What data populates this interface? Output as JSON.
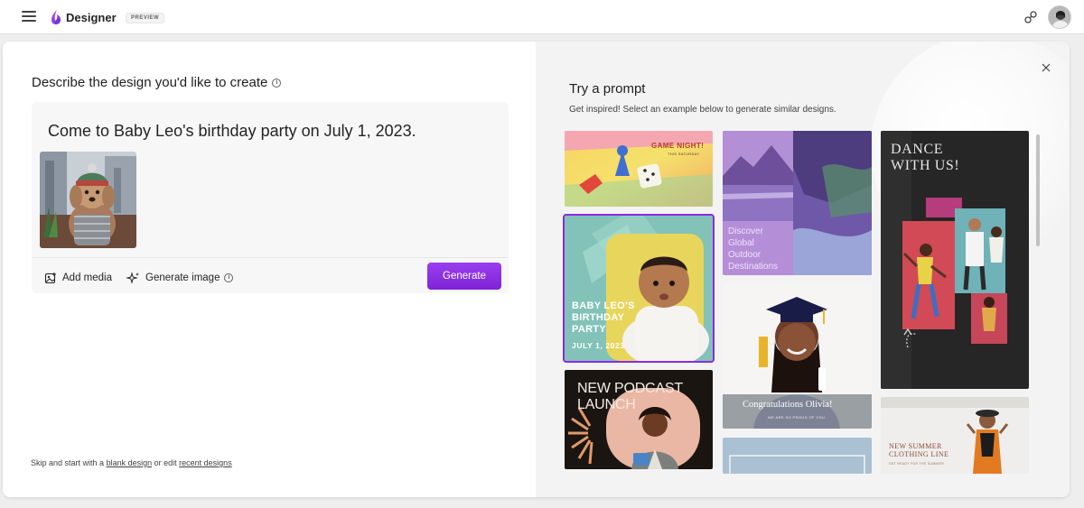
{
  "app": {
    "title": "Designer",
    "badge": "PREVIEW",
    "accent_color": "#8a2be2"
  },
  "topbar": {
    "menu_icon": "hamburger-icon",
    "share_icon": "share-link-icon",
    "avatar": "user-avatar"
  },
  "composer": {
    "heading": "Describe the design you'd like to create",
    "info_icon": "info-icon",
    "prompt_text": "Come to Baby Leo's birthday party on July 1, 2023.",
    "add_media_label": "Add media",
    "generate_image_label": "Generate image",
    "generate_button_label": "Generate"
  },
  "footer": {
    "prefix": "Skip and start with a",
    "blank_design_link": "blank design",
    "middle": "or edit",
    "recent_designs_link": "recent designs"
  },
  "prompts_panel": {
    "title": "Try a prompt",
    "subtitle": "Get inspired! Select an example below to generate similar designs.",
    "close_icon": "close-icon",
    "tiles": {
      "game_night": {
        "line1": "GAME NIGHT!",
        "line2": "THIS SATURDAY"
      },
      "baby_party": {
        "line1": "BABY LEO'S",
        "line2": "BIRTHDAY",
        "line3": "PARTY",
        "date": "JULY 1, 2023"
      },
      "podcast": {
        "line1": "NEW PODCAST",
        "line2": "LAUNCH"
      },
      "outdoor": {
        "line1": "Discover",
        "line2": "Global",
        "line3": "Outdoor",
        "line4": "Destinations"
      },
      "graduation": {
        "line1": "Congratulations Olivia!",
        "line2": "WE ARE SO PROUD OF YOU."
      },
      "dance": {
        "line1": "DANCE",
        "line2": "WITH US!"
      },
      "clothing": {
        "line1": "NEW SUMMER",
        "line2": "CLOTHING LINE",
        "line3": "GET READY FOR THE SUMMER!"
      }
    }
  }
}
